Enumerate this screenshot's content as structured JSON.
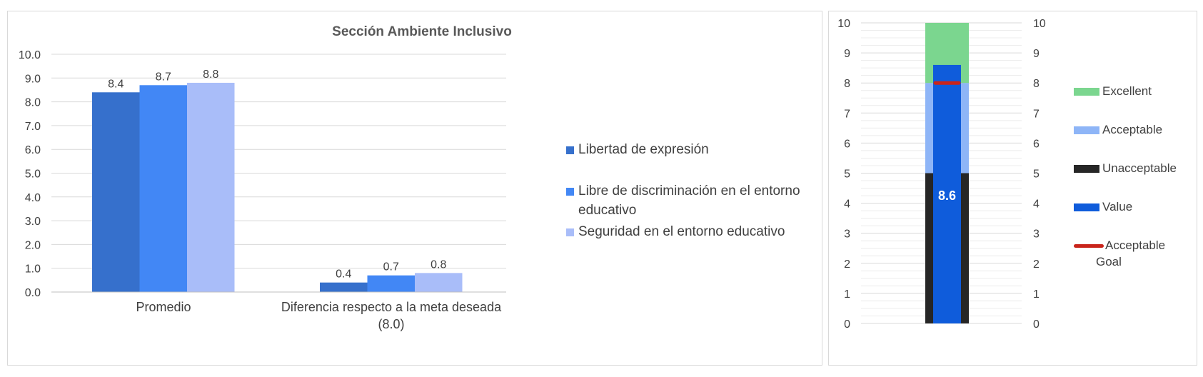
{
  "colors": {
    "series": [
      "#3670CC",
      "#4287F5",
      "#A9BDF9"
    ],
    "excellent": "#7BD68F",
    "acceptable": "#8EB5F7",
    "unacceptable": "#262626",
    "value": "#0F5CDB",
    "goal": "#C9241B",
    "grid": "#d9d9d9",
    "text": "#404040"
  },
  "chart_data": [
    {
      "type": "bar",
      "title": "Sección Ambiente Inclusivo",
      "categories": [
        "Promedio",
        "Diferencia respecto a la meta deseada (8.0)"
      ],
      "category_lines": [
        [
          "Promedio"
        ],
        [
          "Diferencia respecto a la meta deseada",
          "(8.0)"
        ]
      ],
      "series": [
        {
          "name": "Libertad de expresión",
          "values": [
            8.4,
            0.4
          ]
        },
        {
          "name": "Libre de discriminación en el entorno educativo",
          "values": [
            8.7,
            0.7
          ]
        },
        {
          "name": "Seguridad en el entorno educativo",
          "values": [
            8.8,
            0.8
          ]
        }
      ],
      "legend_lines": [
        [
          "Libertad de expresión"
        ],
        [
          "Libre de discriminación en el entorno",
          "educativo"
        ],
        [
          "Seguridad en el entorno educativo"
        ]
      ],
      "ylim": [
        0,
        10
      ],
      "yticks": [
        "0.0",
        "1.0",
        "2.0",
        "3.0",
        "4.0",
        "5.0",
        "6.0",
        "7.0",
        "8.0",
        "9.0",
        "10.0"
      ],
      "data_labels": [
        [
          "8.4",
          "0.4"
        ],
        [
          "8.7",
          "0.7"
        ],
        [
          "8.8",
          "0.8"
        ]
      ],
      "legend_position": "right",
      "grid": true
    },
    {
      "type": "bar",
      "subtype": "bullet-gauge",
      "value": 8.6,
      "value_label": "8.6",
      "goal": 8,
      "bands": [
        {
          "name": "Unacceptable",
          "from": 0,
          "to": 5
        },
        {
          "name": "Acceptable",
          "from": 5,
          "to": 8
        },
        {
          "name": "Excellent",
          "from": 8,
          "to": 10
        }
      ],
      "ylim": [
        0,
        10
      ],
      "yticks": [
        "0",
        "1",
        "2",
        "3",
        "4",
        "5",
        "6",
        "7",
        "8",
        "9",
        "10"
      ],
      "legend": [
        {
          "name": "Excellent",
          "lines": [
            "Excellent"
          ]
        },
        {
          "name": "Acceptable",
          "lines": [
            "Acceptable"
          ]
        },
        {
          "name": "Unacceptable",
          "lines": [
            "Unacceptable"
          ]
        },
        {
          "name": "Value",
          "lines": [
            "Value"
          ]
        },
        {
          "name": "Acceptable Goal",
          "lines": [
            "Acceptable",
            "Goal"
          ]
        }
      ],
      "legend_position": "right",
      "grid": true
    }
  ]
}
